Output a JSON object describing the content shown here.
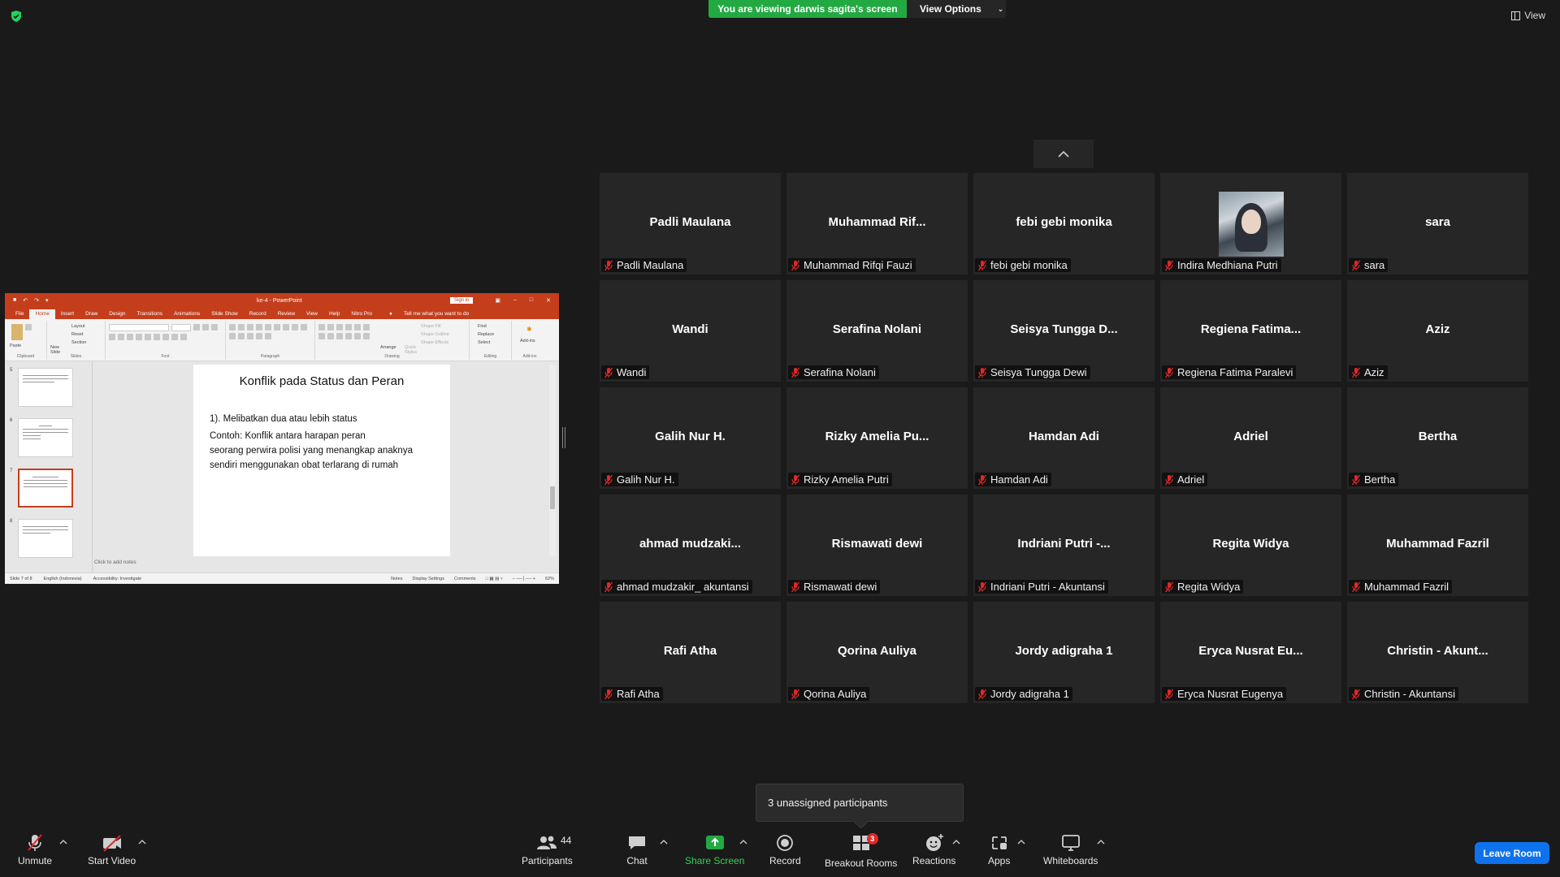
{
  "top": {
    "banner": "You are viewing darwis sagita's screen",
    "view_options": "View Options",
    "view": "View"
  },
  "ppt": {
    "doc_title": "ke-4 - PowerPoint",
    "sign_in": "Sign in",
    "tell_me": "Tell me what you want to do",
    "tabs": [
      "File",
      "Home",
      "Insert",
      "Draw",
      "Design",
      "Transitions",
      "Animations",
      "Slide Show",
      "Record",
      "Review",
      "View",
      "Help",
      "Nitro Pro"
    ],
    "ribbon_groups": [
      "Clipboard",
      "Slides",
      "Font",
      "Paragraph",
      "Drawing",
      "Editing",
      "Add-ins"
    ],
    "ribbon_items": {
      "paste": "Paste",
      "new_slide": "New Slide",
      "layout": "Layout",
      "reset": "Reset",
      "section": "Section",
      "arrange": "Arrange",
      "quick_styles": "Quick Styles",
      "shape_fill": "Shape Fill",
      "shape_outline": "Shape Outline",
      "shape_effects": "Shape Effects",
      "find": "Find",
      "replace": "Replace",
      "select": "Select",
      "addins": "Add-ins"
    },
    "thumb_numbers": [
      "5",
      "6",
      "7",
      "8"
    ],
    "slide_title": "Konflik pada Status dan Peran",
    "slide_lines": [
      "1). Melibatkan dua atau lebih status",
      " Contoh: Konflik antara harapan peran",
      "seorang perwira polisi yang menangkap anaknya",
      "sendiri menggunakan obat terlarang di rumah"
    ],
    "notes": "Click to add notes",
    "status": {
      "slide_of": "Slide 7 of 8",
      "language": "English (Indonesia)",
      "accessibility": "Accessibility: Investigate",
      "notes_btn": "Notes",
      "display": "Display Settings",
      "comments": "Comments",
      "zoom": "62%"
    }
  },
  "participants": [
    {
      "big": "Padli Maulana",
      "name": "Padli Maulana"
    },
    {
      "big": "Muhammad  Rif...",
      "name": "Muhammad Rifqi Fauzi"
    },
    {
      "big": "febi gebi monika",
      "name": "febi gebi monika"
    },
    {
      "big": "",
      "name": "Indira Medhiana Putri",
      "photo": true
    },
    {
      "big": "sara",
      "name": "sara"
    },
    {
      "big": "Wandi",
      "name": "Wandi"
    },
    {
      "big": "Serafina Nolani",
      "name": "Serafina Nolani"
    },
    {
      "big": "Seisya  Tungga  D...",
      "name": "Seisya Tungga Dewi"
    },
    {
      "big": "Regiena  Fatima...",
      "name": "Regiena Fatima Paralevi"
    },
    {
      "big": "Aziz",
      "name": "Aziz"
    },
    {
      "big": "Galih Nur H.",
      "name": "Galih Nur H."
    },
    {
      "big": "Rizky  Amelia  Pu...",
      "name": "Rizky Amelia Putri"
    },
    {
      "big": "Hamdan Adi",
      "name": "Hamdan Adi"
    },
    {
      "big": "Adriel",
      "name": "Adriel"
    },
    {
      "big": "Bertha",
      "name": "Bertha"
    },
    {
      "big": "ahmad  mudzaki...",
      "name": "ahmad mudzakir_ akuntansi"
    },
    {
      "big": "Rismawati dewi",
      "name": "Rismawati dewi"
    },
    {
      "big": "Indriani  Putri  -...",
      "name": "Indriani Putri - Akuntansi"
    },
    {
      "big": "Regita Widya",
      "name": "Regita Widya"
    },
    {
      "big": "Muhammad Fazril",
      "name": "Muhammad Fazril"
    },
    {
      "big": "Rafi Atha",
      "name": "Rafi Atha"
    },
    {
      "big": "Qorina Auliya",
      "name": "Qorina Auliya"
    },
    {
      "big": "Jordy adigraha 1",
      "name": "Jordy adigraha 1"
    },
    {
      "big": "Eryca  Nusrat  Eu...",
      "name": "Eryca Nusrat Eugenya"
    },
    {
      "big": "Christin  - Akunt...",
      "name": "Christin  - Akuntansi"
    }
  ],
  "unassigned": "3 unassigned participants",
  "toolbar": {
    "unmute": "Unmute",
    "start_video": "Start Video",
    "participants": "Participants",
    "participants_count": "44",
    "chat": "Chat",
    "share_screen": "Share Screen",
    "record": "Record",
    "breakout": "Breakout Rooms",
    "breakout_badge": "3",
    "reactions": "Reactions",
    "apps": "Apps",
    "whiteboards": "Whiteboards",
    "leave": "Leave Room"
  },
  "colors": {
    "background": "#1a1a1a",
    "tile": "#262626",
    "banner_green": "#23a942",
    "share_green": "#36d158",
    "leave_blue": "#0e72ed",
    "muted_red": "#e02828",
    "ppt_red": "#c43e1c"
  }
}
